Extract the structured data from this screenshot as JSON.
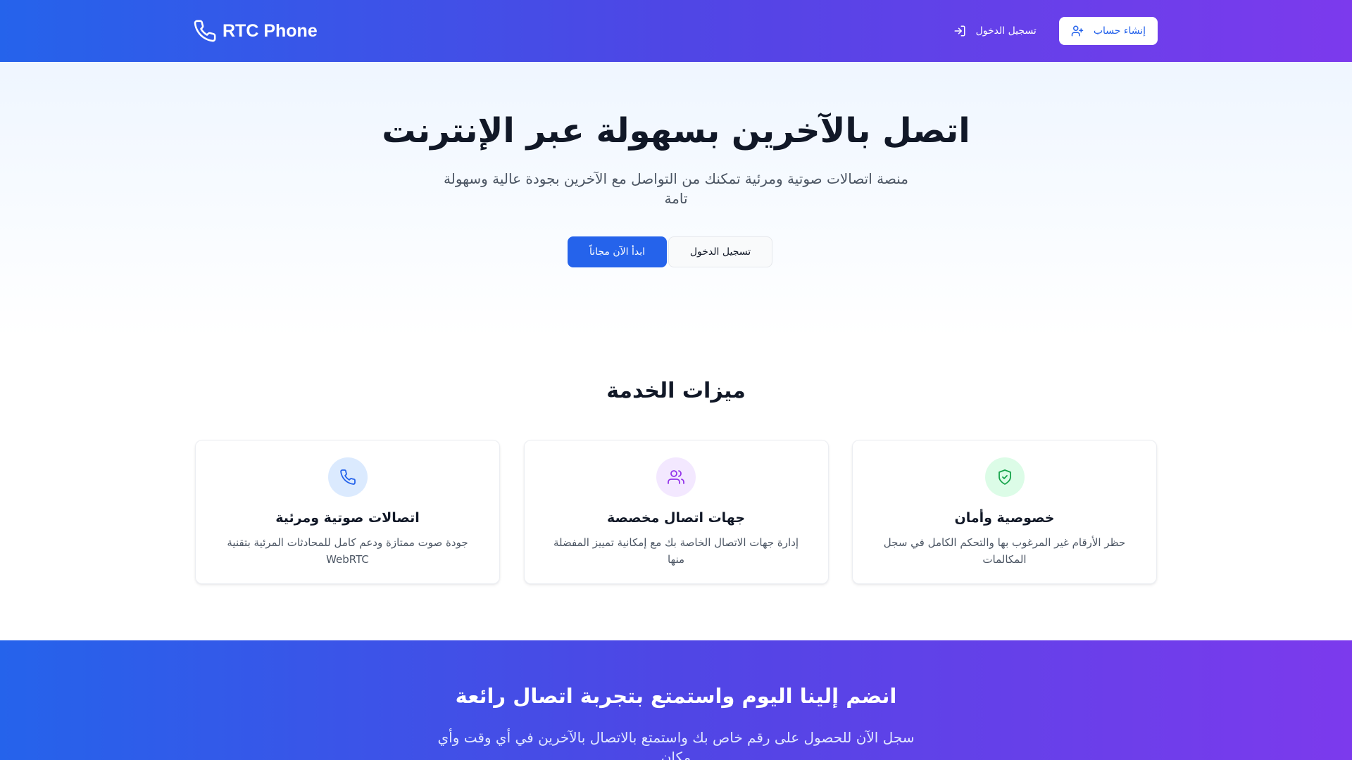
{
  "header": {
    "brand_name": "RTC Phone",
    "brand_icon": "phone-icon",
    "login_label": "تسجيل الدخول",
    "login_icon": "login-icon",
    "signup_label": "إنشاء حساب",
    "signup_icon": "user-plus-icon"
  },
  "hero": {
    "title": "اتصل بالآخرين بسهولة عبر الإنترنت",
    "subtitle": "منصة اتصالات صوتية ومرئية تمكنك من التواصل مع الآخرين بجودة عالية وسهولة تامة",
    "primary_button": "ابدأ الآن مجاناً",
    "secondary_button": "تسجيل الدخول"
  },
  "features": {
    "title": "ميزات الخدمة",
    "cards": [
      {
        "title": "اتصالات صوتية ومرئية",
        "description": "جودة صوت ممتازة ودعم كامل للمحادثات المرئية بتقنية WebRTC",
        "icon": "phone-icon",
        "icon_color": "#2563eb",
        "icon_bg": "#dbeafe"
      },
      {
        "title": "جهات اتصال مخصصة",
        "description": "إدارة جهات الاتصال الخاصة بك مع إمكانية تمييز المفضلة منها",
        "icon": "users-icon",
        "icon_color": "#9333ea",
        "icon_bg": "#f3e8ff"
      },
      {
        "title": "خصوصية وأمان",
        "description": "حظر الأرقام غير المرغوب بها والتحكم الكامل في سجل المكالمات",
        "icon": "shield-check-icon",
        "icon_color": "#16a34a",
        "icon_bg": "#dcfce7"
      }
    ]
  },
  "cta": {
    "title": "انضم إلينا اليوم واستمتع بتجربة اتصال رائعة",
    "text": "سجل الآن للحصول على رقم خاص بك واستمتع بالاتصال بالآخرين في أي وقت وأي مكان"
  },
  "colors": {
    "primary": "#2563eb",
    "gradient_start": "#2563eb",
    "gradient_end": "#7c3aed"
  }
}
